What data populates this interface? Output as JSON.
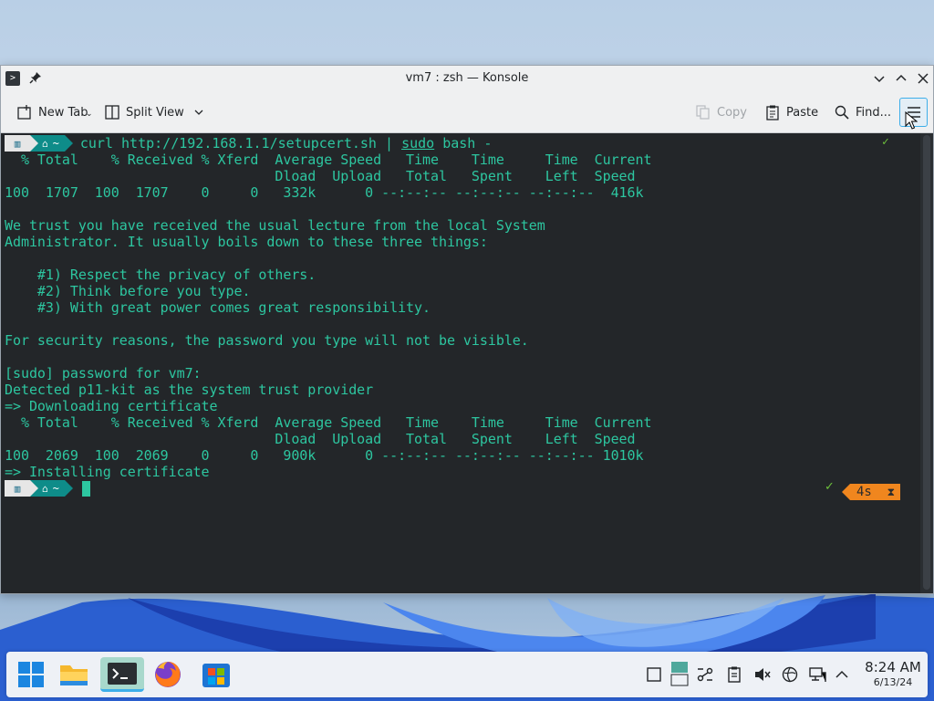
{
  "window": {
    "title": "vm7 : zsh — Konsole"
  },
  "toolbar": {
    "new_tab": "New Tab",
    "split_view": "Split View",
    "copy": "Copy",
    "paste": "Paste",
    "find": "Find..."
  },
  "terminal": {
    "prompt_home": "~",
    "command_prefix": "curl http://192.168.1.1/setupcert.sh | ",
    "command_sudo": "sudo",
    "command_suffix": " bash -",
    "lines": [
      "  % Total    % Received % Xferd  Average Speed   Time    Time     Time  Current",
      "                                 Dload  Upload   Total   Spent    Left  Speed",
      "100  1707  100  1707    0     0   332k      0 --:--:-- --:--:-- --:--:--  416k",
      "",
      "We trust you have received the usual lecture from the local System",
      "Administrator. It usually boils down to these three things:",
      "",
      "    #1) Respect the privacy of others.",
      "    #2) Think before you type.",
      "    #3) With great power comes great responsibility.",
      "",
      "For security reasons, the password you type will not be visible.",
      "",
      "[sudo] password for vm7:",
      "Detected p11-kit as the system trust provider",
      "=> Downloading certificate",
      "  % Total    % Received % Xferd  Average Speed   Time    Time     Time  Current",
      "                                 Dload  Upload   Total   Spent    Left  Speed",
      "100  2069  100  2069    0     0   900k      0 --:--:-- --:--:-- --:--:-- 1010k",
      "=> Installing certificate"
    ],
    "status_check": "✓",
    "timer_label": "4s",
    "timer_icon": "⧗"
  },
  "taskbar": {
    "apps": [
      "start-menu",
      "file-manager",
      "konsole",
      "firefox",
      "store"
    ],
    "clock_time": "8:24 AM",
    "clock_date": "6/13/24"
  },
  "colors": {
    "terminal_bg": "#232629",
    "terminal_fg": "#2dc6a0",
    "accent": "#3daee9",
    "prompt_home_bg": "#0e8c89",
    "timer_bg": "#f0861e"
  }
}
